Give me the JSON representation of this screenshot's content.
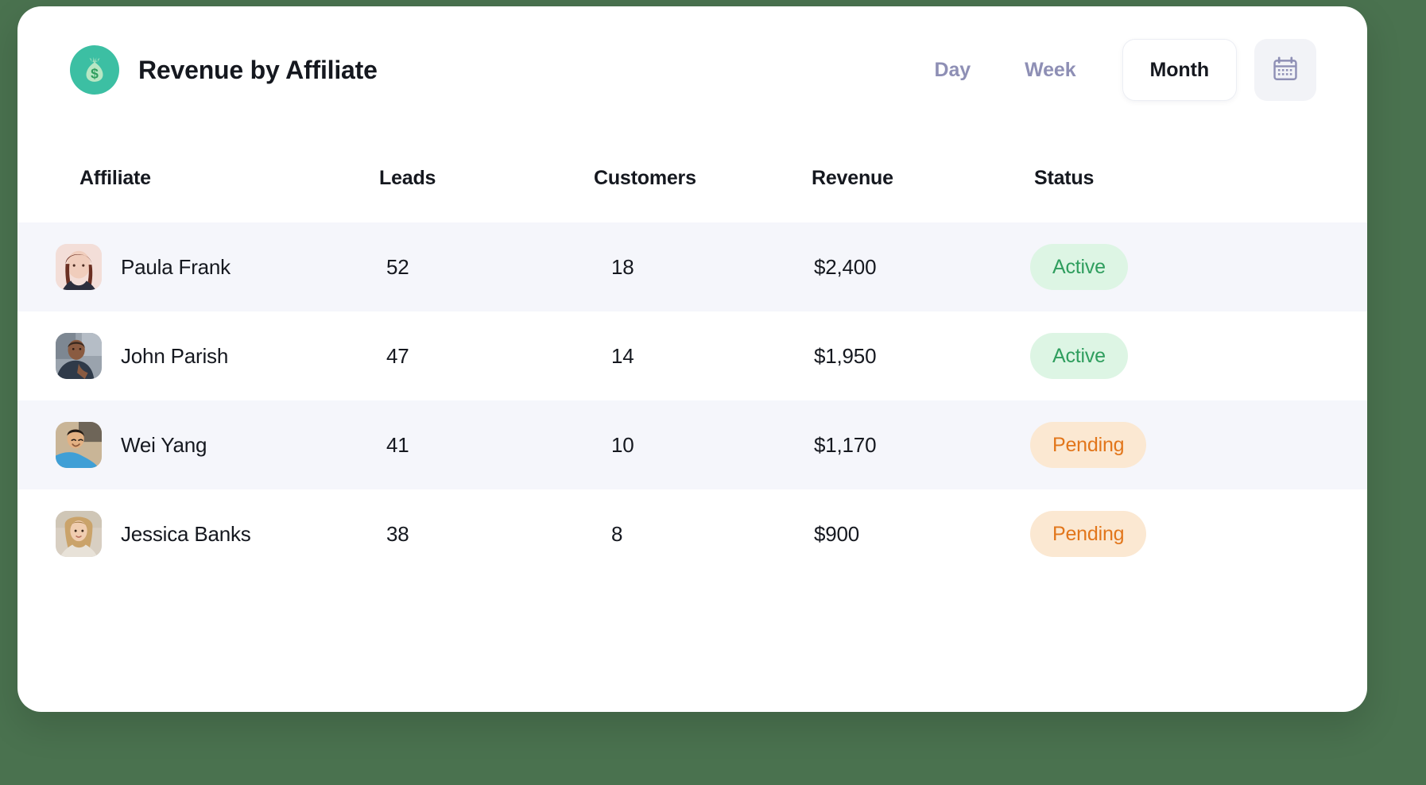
{
  "theme": {
    "page_background": "#4a724f",
    "card_background": "#ffffff",
    "accent": "#3cbfa3",
    "stripe": "#f5f6fb",
    "muted_text": "#8e8fb5",
    "active_badge_bg": "#ddf5e4",
    "active_badge_text": "#2f9e5e",
    "pending_badge_bg": "#fbe8d2",
    "pending_badge_text": "#e2761b"
  },
  "header": {
    "title": "Revenue by Affiliate",
    "logo_icon": "money-bag-icon",
    "ranges": [
      {
        "label": "Day",
        "active": false
      },
      {
        "label": "Week",
        "active": false
      },
      {
        "label": "Month",
        "active": true
      }
    ],
    "calendar_icon": "calendar-icon"
  },
  "table": {
    "columns": [
      "Affiliate",
      "Leads",
      "Customers",
      "Revenue",
      "Status"
    ],
    "rows": [
      {
        "avatar": "avatar-paula-frank",
        "name": "Paula Frank",
        "leads": "52",
        "customers": "18",
        "revenue": "$2,400",
        "status": "Active",
        "status_kind": "active"
      },
      {
        "avatar": "avatar-john-parish",
        "name": "John Parish",
        "leads": "47",
        "customers": "14",
        "revenue": "$1,950",
        "status": "Active",
        "status_kind": "active"
      },
      {
        "avatar": "avatar-wei-yang",
        "name": "Wei Yang",
        "leads": "41",
        "customers": "10",
        "revenue": "$1,170",
        "status": "Pending",
        "status_kind": "pending"
      },
      {
        "avatar": "avatar-jessica-banks",
        "name": "Jessica Banks",
        "leads": "38",
        "customers": "8",
        "revenue": "$900",
        "status": "Pending",
        "status_kind": "pending"
      }
    ]
  }
}
